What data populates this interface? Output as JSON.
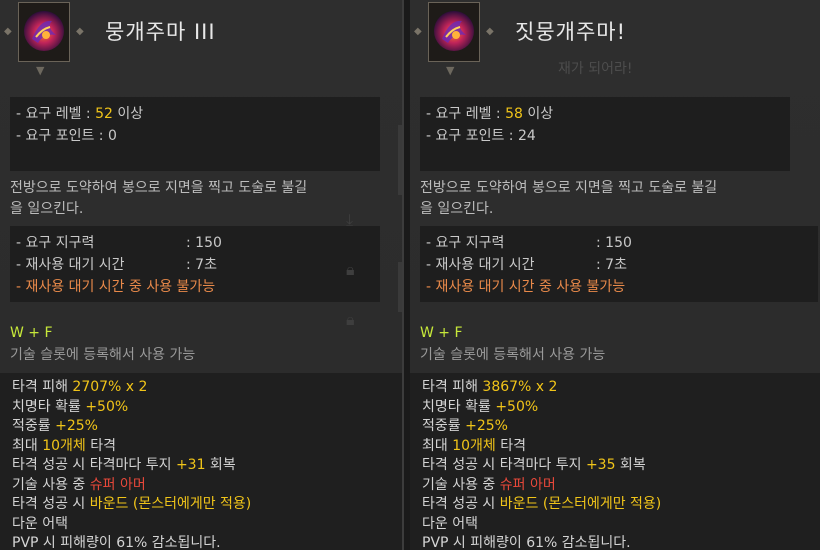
{
  "left": {
    "title": "뭉개주마 III",
    "req_level_label": "- 요구 레벨 : ",
    "req_level_value": "52",
    "req_level_suffix": " 이상",
    "req_point": "- 요구 포인트 : 0",
    "desc_line1": "전방으로 도약하여 봉으로 지면을 찍고 도술로 불길",
    "desc_line2": "을 일으킨다.",
    "cost_label": "- 요구 지구력",
    "cost_value": ": 150",
    "cd_label": "- 재사용 대기 시간",
    "cd_value": ": 7초",
    "cd_note": "- 재사용 대기 시간 중 사용 불가능",
    "keys": "W + F",
    "slot_note": "기술 슬롯에 등록해서 사용 가능",
    "dmg_label": "타격 피해 ",
    "dmg_value": "2707% x 2",
    "crit_label": "치명타 확률 ",
    "crit_value": "+50%",
    "acc_label": "적중률 ",
    "acc_value": "+25%",
    "max_label": "최대 ",
    "max_value": "10개체",
    "max_suffix": " 타격",
    "wp_label": "타격 성공 시 타격마다 투지 ",
    "wp_value": "+31",
    "wp_suffix": " 회복",
    "sa_label": "기술 사용 중 ",
    "sa_value": "슈퍼 아머",
    "bound_label": "타격 성공 시 ",
    "bound_value": "바운드 (몬스터에게만 적용)",
    "down": "다운 어택",
    "pvp": "PVP 시 피해량이 61% 감소됩니다."
  },
  "right": {
    "title": "짓뭉개주마!",
    "faded_text": "재가 되어라!",
    "req_level_label": "- 요구 레벨 : ",
    "req_level_value": "58",
    "req_level_suffix": " 이상",
    "req_point": "- 요구 포인트 : 24",
    "desc_line1": "전방으로 도약하여 봉으로 지면을 찍고 도술로 불길",
    "desc_line2": "을 일으킨다.",
    "cost_label": "- 요구 지구력",
    "cost_value": ": 150",
    "cd_label": "- 재사용 대기 시간",
    "cd_value": ": 7초",
    "cd_note": "- 재사용 대기 시간 중 사용 불가능",
    "keys": "W + F",
    "slot_note": "기술 슬롯에 등록해서 사용 가능",
    "dmg_label": "타격 피해 ",
    "dmg_value": "3867% x 2",
    "crit_label": "치명타 확률 ",
    "crit_value": "+50%",
    "acc_label": "적중률 ",
    "acc_value": "+25%",
    "max_label": "최대 ",
    "max_value": "10개체",
    "max_suffix": " 타격",
    "wp_label": "타격 성공 시 타격마다 투지 ",
    "wp_value": "+35",
    "wp_suffix": " 회복",
    "sa_label": "기술 사용 중 ",
    "sa_value": "슈퍼 아머",
    "bound_label": "타격 성공 시 ",
    "bound_value": "바운드 (몬스터에게만 적용)",
    "down": "다운 어택",
    "pvp": "PVP 시 피해량이 61% 감소됩니다."
  },
  "icons": {
    "skill": "fire-staff-skill-icon",
    "lock": "lock-icon",
    "download": "download-icon",
    "frame_arrow": "frame-arrow-icon"
  },
  "colors": {
    "highlight": "#f0c419",
    "warning": "#e8894a",
    "key": "#c7e83a",
    "super_armor": "#e8483a",
    "down_attack": "#39b5e8"
  }
}
